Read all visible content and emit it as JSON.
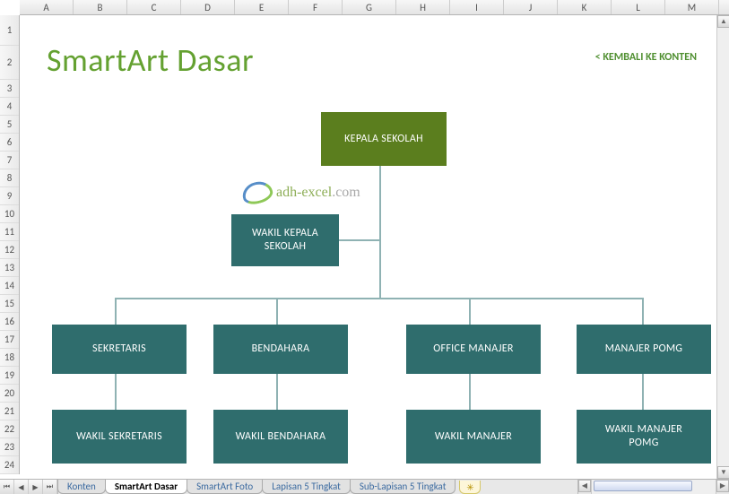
{
  "columns": [
    "A",
    "B",
    "C",
    "D",
    "E",
    "F",
    "G",
    "H",
    "I",
    "J",
    "K",
    "L",
    "M"
  ],
  "rows": [
    "1",
    "2",
    "3",
    "4",
    "5",
    "6",
    "7",
    "8",
    "9",
    "10",
    "11",
    "12",
    "13",
    "14",
    "15",
    "16",
    "17",
    "18",
    "19",
    "20",
    "21",
    "22",
    "23",
    "24"
  ],
  "title": "SmartArt Dasar",
  "back_link": "< KEMBALI KE KONTEN",
  "watermark_main": "adh-excel",
  "watermark_suffix": ".com",
  "nodes": {
    "kepala": "KEPALA SEKOLAH",
    "wakil_kepala_l1": "WAKIL KEPALA",
    "wakil_kepala_l2": "SEKOLAH",
    "sekretaris": "SEKRETARIS",
    "bendahara": "BENDAHARA",
    "office_manajer": "OFFICE MANAJER",
    "manajer_pomg": "MANAJER POMG",
    "wakil_sekretaris": "WAKIL SEKRETARIS",
    "wakil_bendahara": "WAKIL BENDAHARA",
    "wakil_manajer": "WAKIL MANAJER",
    "wakil_manajer_pomg_l1": "WAKIL MANAJER",
    "wakil_manajer_pomg_l2": "POMG"
  },
  "tabs": {
    "konten": "Konten",
    "smartart_dasar": "SmartArt Dasar",
    "smartart_foto": "SmartArt Foto",
    "lapisan5": "Lapisan 5 Tingkat",
    "sublapisan5": "Sub-Lapisan 5 Tingkat"
  },
  "nav": {
    "first": "⏮",
    "prev": "◀",
    "next": "▶",
    "last": "⏭"
  },
  "newtab_icon": "✳",
  "scroll": {
    "up": "▲",
    "down": "▼",
    "left": "◀",
    "right": "▶"
  },
  "chart_data": {
    "type": "org",
    "title": "SmartArt Dasar",
    "root": {
      "label": "KEPALA SEKOLAH",
      "assistant": {
        "label": "WAKIL KEPALA SEKOLAH"
      },
      "children": [
        {
          "label": "SEKRETARIS",
          "children": [
            {
              "label": "WAKIL SEKRETARIS"
            }
          ]
        },
        {
          "label": "BENDAHARA",
          "children": [
            {
              "label": "WAKIL BENDAHARA"
            }
          ]
        },
        {
          "label": "OFFICE MANAJER",
          "children": [
            {
              "label": "WAKIL MANAJER"
            }
          ]
        },
        {
          "label": "MANAJER POMG",
          "children": [
            {
              "label": "WAKIL MANAJER POMG"
            }
          ]
        }
      ]
    }
  }
}
